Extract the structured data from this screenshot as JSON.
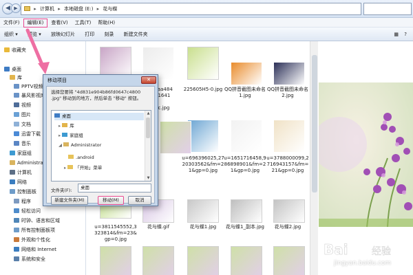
{
  "address_bar": {
    "crumbs": [
      "计算机",
      "本地磁盘 (E:)",
      "花与蝶"
    ]
  },
  "menu": [
    "文件(F)",
    "编辑(E)",
    "查看(V)",
    "工具(T)",
    "帮助(H)"
  ],
  "toolbar": [
    "组织 ▾",
    "预览 ▾",
    "放映幻灯片",
    "打印",
    "刻录",
    "新建文件夹"
  ],
  "nav": {
    "favorites": "收藏夹",
    "desktop": "桌面",
    "library": "库",
    "pptv": "PPTV视频",
    "baofeng": "暴风影视库",
    "video": "视频",
    "pictures": "图片",
    "docs": "文档",
    "xunlei": "迅雷下载",
    "music": "音乐",
    "homegroup": "家庭组",
    "admin": "Administrator",
    "computer": "计算机",
    "network": "网络",
    "control_panel": "控制面板",
    "programs": "程序",
    "ease": "轻松访问",
    "clock": "时钟、语言和区域",
    "all_cp": "所有控制面板项",
    "appearance": "外观和个性化",
    "net_internet": "网络和 Internet",
    "security": "系统和安全"
  },
  "files": [
    {
      "caption": "",
      "color": "#c9a6c7"
    },
    {
      "caption": "",
      "color": "#ececec"
    },
    {
      "caption": "225605H5-0.jpg",
      "color": "#c9df8e"
    },
    {
      "caption": "QQ拼音截图未命名1.jpg",
      "color": "#e98c2c"
    },
    {
      "caption": "QQ拼音截图未命名2.jpg",
      "color": "#2b2f57"
    },
    {
      "caption": "u=1651716458,986898901&fm=21&gp=0.jpg",
      "color": "#f2f2f2"
    },
    {
      "caption": "u=696396025,2720303562&fm=21&gp=0.jpg",
      "color": "#6aa4d2"
    },
    {
      "caption": "u=3788000099,2716943157&fm=21&gp=0.jpg",
      "color": "#f0e2c6"
    },
    {
      "caption": "u=3811545552,3323814&fm=23&gp=0.jpg",
      "color": "#b8d878"
    },
    {
      "caption": "花与蝶.gif",
      "color": "#d8c6e4"
    },
    {
      "caption": "花与蝶1.jpg",
      "color": "#c8c8c8"
    },
    {
      "caption": "花与蝶1_副本.jpg",
      "color": "#bfbfbf"
    },
    {
      "caption": "花与蝶2.jpg",
      "color": "#c3c3c3"
    }
  ],
  "truncated_captions": [
    "caa484",
    "41641d",
    "dc.jpg"
  ],
  "dialog": {
    "title": "移动项目",
    "close": "✕",
    "message": "选择您要将 \"4d831e904b86fd0647c4800 .jpg\" 移动到的地方，然后单击 \"移动\" 按钮。",
    "tree": [
      "桌面",
      "库",
      "家庭组",
      "Administrator",
      ".android",
      "「开始」菜单"
    ],
    "folder_label": "文件夹(F):",
    "folder_value": "桌面",
    "new_folder": "新建文件夹(M)",
    "move": "移动(M)",
    "cancel": "取消"
  },
  "watermark": "jingyan.baidu.com"
}
